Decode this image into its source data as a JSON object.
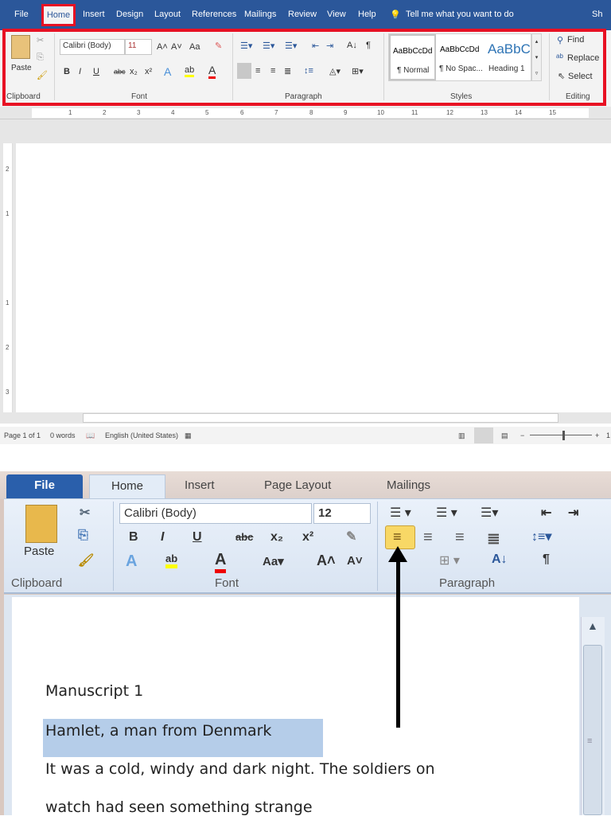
{
  "top": {
    "tabs": [
      "File",
      "Home",
      "Insert",
      "Design",
      "Layout",
      "References",
      "Mailings",
      "Review",
      "View",
      "Help"
    ],
    "tell_me": "Tell me what you want to do",
    "share": "Sh",
    "clipboard": {
      "paste": "Paste",
      "label": "Clipboard"
    },
    "font": {
      "name": "Calibri (Body)",
      "size": "11",
      "label": "Font",
      "bold": "B",
      "italic": "I",
      "underline": "U",
      "strike": "abc",
      "sub": "x₂",
      "sup": "x²",
      "grow": "A˄",
      "shrink": "A˅",
      "case": "Aa",
      "color": "A"
    },
    "paragraph": {
      "label": "Paragraph",
      "pilcrow": "¶"
    },
    "styles": {
      "label": "Styles",
      "items": [
        {
          "preview": "AaBbCcDd",
          "name": "¶ Normal"
        },
        {
          "preview": "AaBbCcDd",
          "name": "¶ No Spac..."
        },
        {
          "preview": "AaBbCc",
          "name": "Heading 1"
        }
      ]
    },
    "editing": {
      "label": "Editing",
      "find": "Find",
      "replace": "Replace",
      "select": "Select"
    },
    "ruler": [
      "1",
      "2",
      "3",
      "4",
      "5",
      "6",
      "7",
      "8",
      "9",
      "10",
      "11",
      "12",
      "13",
      "14",
      "15"
    ],
    "vruler": [
      "2",
      "1",
      "1",
      "2",
      "3"
    ],
    "status": {
      "page": "Page 1 of 1",
      "words": "0 words",
      "language": "English (United States)",
      "zoom": "1"
    }
  },
  "bottom": {
    "tabs": [
      "File",
      "Home",
      "Insert",
      "Page Layout",
      "Mailings"
    ],
    "font_name": "Calibri (Body)",
    "font_size": "12",
    "paste": "Paste",
    "clipboard_label": "Clipboard",
    "font_label": "Font",
    "paragraph_label": "Paragraph",
    "document": [
      "Manuscript 1",
      "Hamlet, a man from Denmark",
      "It was a cold, windy and dark night. The soldiers on",
      "watch had seen something strange"
    ]
  },
  "colors": {
    "word_blue": "#2b579a",
    "highlight_box": "#e81123",
    "selection": "#b5cde9",
    "align_active": "#f8d866"
  }
}
